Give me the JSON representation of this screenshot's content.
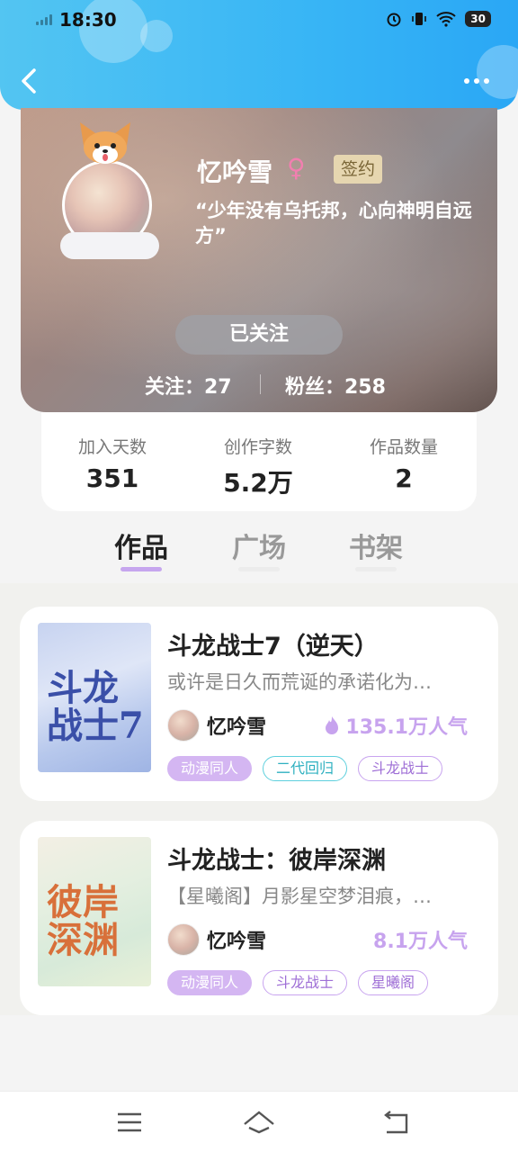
{
  "status_bar": {
    "time": "18:30",
    "battery": "30"
  },
  "header": {
    "back_icon": "chevron-left-icon",
    "more_icon": "more-dots-icon"
  },
  "profile": {
    "name": "忆吟雪",
    "gender_symbol": "♀",
    "sign_badge": "签约",
    "motto": "“少年没有乌托邦，心向神明自远方”",
    "follow_button": "已关注",
    "following_label": "关注：27",
    "fans_label": "粉丝：258"
  },
  "stats": [
    {
      "label": "加入天数",
      "value": "351"
    },
    {
      "label": "创作字数",
      "value": "5.2万"
    },
    {
      "label": "作品数量",
      "value": "2"
    }
  ],
  "tabs": [
    {
      "label": "作品",
      "active": true
    },
    {
      "label": "广场",
      "active": false
    },
    {
      "label": "书架",
      "active": false
    }
  ],
  "works": [
    {
      "title": "斗龙战士7（逆天）",
      "description": "或许是日久而荒诞的承诺化为…",
      "author": "忆吟雪",
      "popularity": "135.1万人气",
      "hot_icon": true,
      "cover_text": "斗龙战士7",
      "tags": [
        "动漫同人",
        "二代回归",
        "斗龙战士"
      ]
    },
    {
      "title": "斗龙战士：彼岸深渊",
      "description": "【星曦阁】月影星空梦泪痕，…",
      "author": "忆吟雪",
      "popularity": "8.1万人气",
      "hot_icon": false,
      "cover_text": "彼岸深渊",
      "tags": [
        "动漫同人",
        "斗龙战士",
        "星曦阁"
      ]
    }
  ],
  "colors": {
    "accent": "#c6a6ee",
    "header_blue": "#38b5f5",
    "gender_pink": "#f27fb0"
  }
}
